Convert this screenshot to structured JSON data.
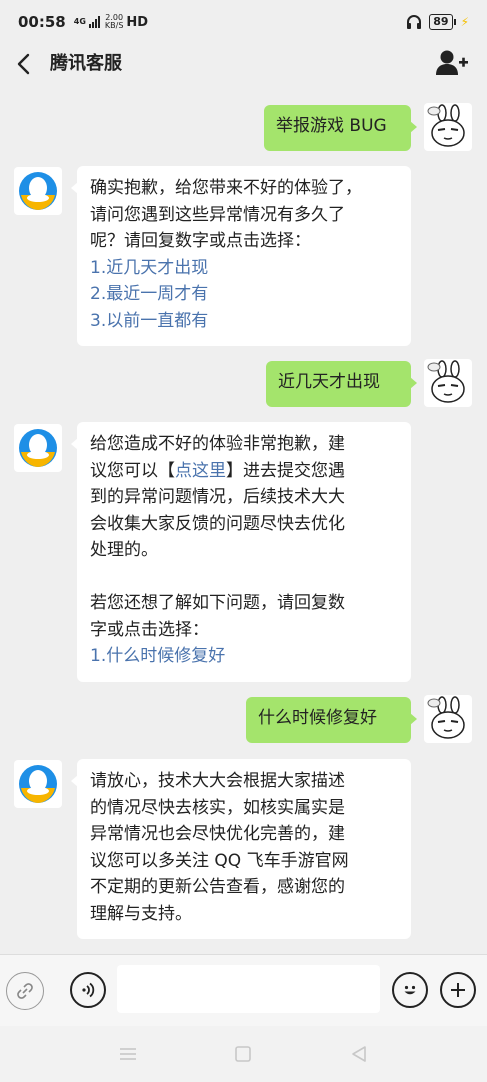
{
  "status_bar": {
    "time": "00:58",
    "network": "4G",
    "speed_value": "2.00",
    "speed_unit": "KB/S",
    "hd": "HD",
    "battery": "89"
  },
  "header": {
    "title": "腾讯客服"
  },
  "messages": [
    {
      "from": "user",
      "text": "举报游戏 BUG"
    },
    {
      "from": "bot",
      "lines": [
        "确实抱歉，给您带来不好的体验了，",
        "请问您遇到这些异常情况有多久了",
        "呢？请回复数字或点击选择："
      ],
      "options": [
        "1.近几天才出现",
        "2.最近一周才有",
        "3.以前一直都有"
      ]
    },
    {
      "from": "user",
      "text": "近几天才出现"
    },
    {
      "from": "bot",
      "line1_prefix": "给您造成不好的体验非常抱歉，建",
      "line2_prefix": "议您可以【",
      "line2_link": "点这里",
      "line2_suffix": "】进去提交您遇",
      "lines_rest": [
        "到的异常问题情况，后续技术大大",
        "会收集大家反馈的问题尽快去优化",
        "处理的。"
      ],
      "lines_more": [
        "若您还想了解如下问题，请回复数",
        "字或点击选择："
      ],
      "options": [
        "1.什么时候修复好"
      ]
    },
    {
      "from": "user",
      "text": "什么时候修复好"
    },
    {
      "from": "bot",
      "lines": [
        "请放心，技术大大会根据大家描述",
        "的情况尽快去核实，如核实属实是",
        "异常情况也会尽快优化完善的，建",
        "议您可以多关注 QQ 飞车手游官网",
        "不定期的更新公告查看，感谢您的",
        "理解与支持。"
      ]
    }
  ],
  "input_bar": {
    "placeholder": ""
  },
  "colors": {
    "background": "#efefef",
    "outgoing_bubble": "#a4e46c",
    "incoming_bubble": "#ffffff",
    "link": "#4a73ad"
  }
}
